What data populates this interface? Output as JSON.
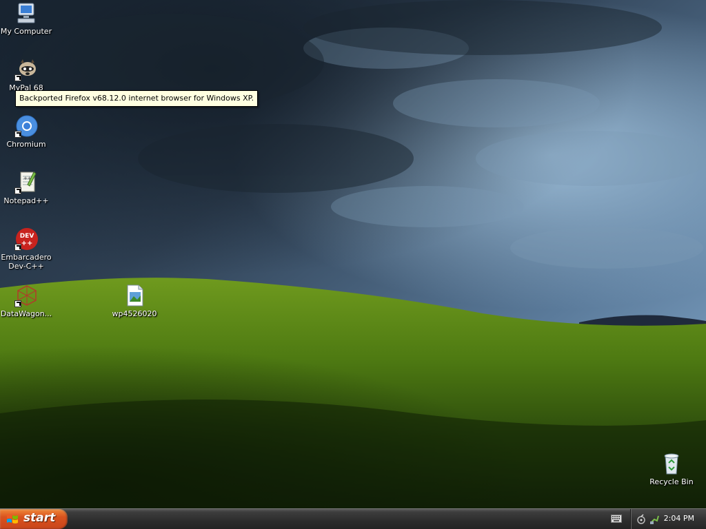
{
  "desktop": {
    "icons": [
      {
        "label": "My Computer",
        "icon": "computer-icon"
      },
      {
        "label": "MyPal 68",
        "icon": "mypal-raccoon-icon",
        "shortcut": true
      },
      {
        "label": "Chromium",
        "icon": "chromium-icon",
        "shortcut": true
      },
      {
        "label": "Notepad++",
        "icon": "notepadpp-icon",
        "shortcut": true
      },
      {
        "label": "Embarcadero Dev-C++",
        "icon": "devcpp-icon",
        "shortcut": true,
        "icon_text": "DEV\n++"
      },
      {
        "label": "DataWagon...",
        "icon": "datawagon-icon",
        "shortcut": true
      },
      {
        "label": "wp4526020",
        "icon": "image-file-icon"
      },
      {
        "label": "Recycle Bin",
        "icon": "recycle-bin-icon"
      }
    ],
    "tooltip": "Backported Firefox v68.12.0 internet browser for Windows XP."
  },
  "taskbar": {
    "start_label": "start",
    "tray_icons": [
      "keyboard-icon",
      "network-icon",
      "safely-remove-icon"
    ],
    "clock": "2:04 PM"
  },
  "colors": {
    "start_button": "#d9531e",
    "taskbar": "#2c2c2c",
    "tooltip_bg": "#ffffe1"
  }
}
